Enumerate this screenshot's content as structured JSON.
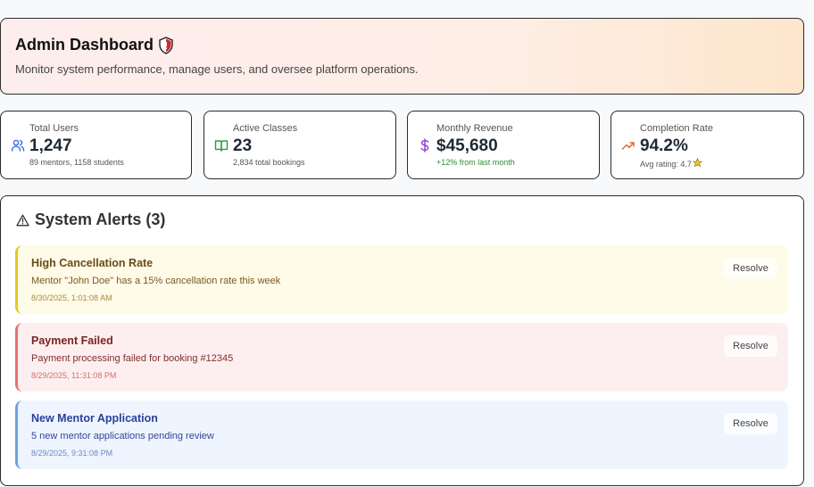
{
  "header": {
    "title": "Admin Dashboard",
    "subtitle": "Monitor system performance, manage users, and oversee platform operations.",
    "title_icon": "shield-icon"
  },
  "stats": [
    {
      "label": "Total Users",
      "value": "1,247",
      "sub": "89 mentors, 1158 students",
      "icon": "users-icon",
      "icon_color": "#3b6fd8"
    },
    {
      "label": "Active Classes",
      "value": "23",
      "sub": "2,834 total bookings",
      "icon": "book-icon",
      "icon_color": "#2e9a4a"
    },
    {
      "label": "Monthly Revenue",
      "value": "$45,680",
      "sub": "+12% from last month",
      "icon": "dollar-icon",
      "icon_color": "#9b3fd8"
    },
    {
      "label": "Completion Rate",
      "value": "94.2%",
      "sub": "Avg rating: 4.7",
      "icon": "trending-up-icon",
      "icon_color": "#e2682b"
    }
  ],
  "alerts": {
    "title": "System Alerts (3)",
    "items": [
      {
        "title": "High Cancellation Rate",
        "message": "Mentor \"John Doe\" has a 15% cancellation rate this week",
        "time": "8/30/2025, 1:01:08 AM",
        "action": "Resolve",
        "severity": "warning"
      },
      {
        "title": "Payment Failed",
        "message": "Payment processing failed for booking #12345",
        "time": "8/29/2025, 11:31:08 PM",
        "action": "Resolve",
        "severity": "error"
      },
      {
        "title": "New Mentor Application",
        "message": "5 new mentor applications pending review",
        "time": "8/29/2025, 9:31:08 PM",
        "action": "Resolve",
        "severity": "info"
      }
    ]
  }
}
